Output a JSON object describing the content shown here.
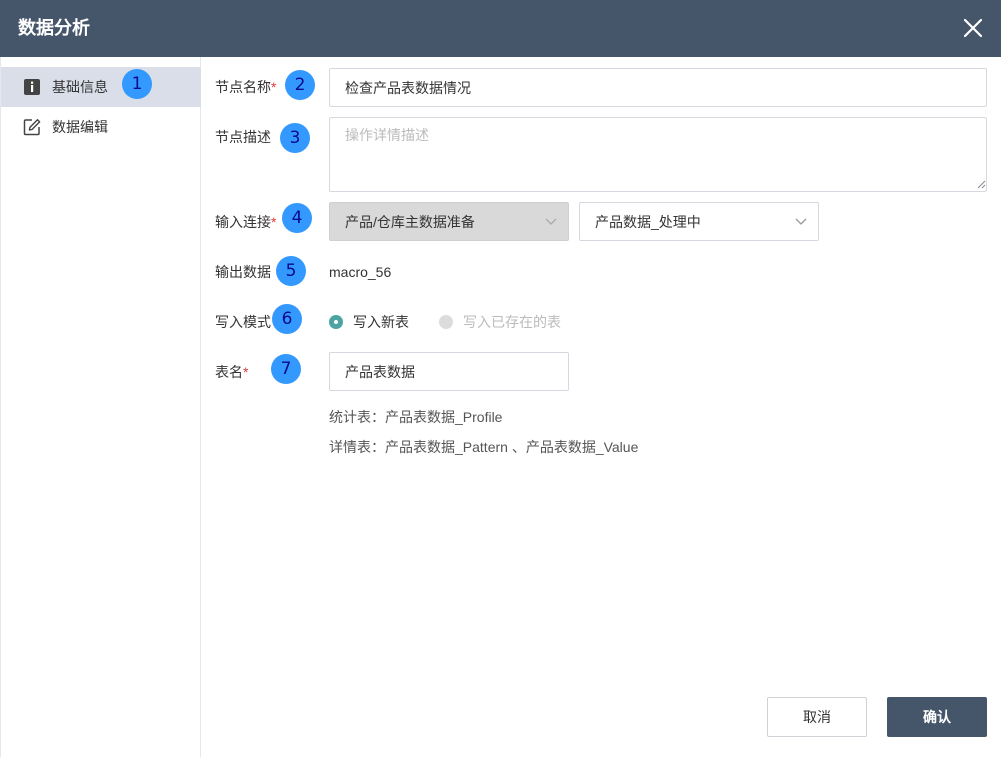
{
  "dialog": {
    "title": "数据分析",
    "close_icon": "close-icon"
  },
  "sidebar": {
    "items": [
      {
        "label": "基础信息",
        "icon": "info-icon",
        "active": true
      },
      {
        "label": "数据编辑",
        "icon": "edit-icon",
        "active": false
      }
    ]
  },
  "badges": [
    "1",
    "2",
    "3",
    "4",
    "5",
    "6",
    "7"
  ],
  "form": {
    "node_name": {
      "label": "节点名称",
      "required_mark": "*",
      "value": "检查产品表数据情况"
    },
    "node_desc": {
      "label": "节点描述",
      "placeholder": "操作详情描述",
      "value": ""
    },
    "input_conn": {
      "label": "输入连接",
      "required_mark": "*",
      "select1": "产品/仓库主数据准备",
      "select2": "产品数据_处理中"
    },
    "output_data": {
      "label": "输出数据",
      "value": "macro_56"
    },
    "write_mode": {
      "label": "写入模式",
      "options": [
        {
          "label": "写入新表",
          "selected": true
        },
        {
          "label": "写入已存在的表",
          "selected": false
        }
      ]
    },
    "table_name": {
      "label": "表名",
      "required_mark": "*",
      "value": "产品表数据",
      "stats_line": "统计表：产品表数据_Profile",
      "detail_line": "详情表：产品表数据_Pattern 、产品表数据_Value"
    }
  },
  "footer": {
    "cancel_label": "取消",
    "ok_label": "确认"
  },
  "colors": {
    "header_bg": "#46566a",
    "sidebar_active_bg": "#d9dee8",
    "badge": "#3399ff",
    "radio_on": "#4ba4a4",
    "required": "#e0393e"
  }
}
